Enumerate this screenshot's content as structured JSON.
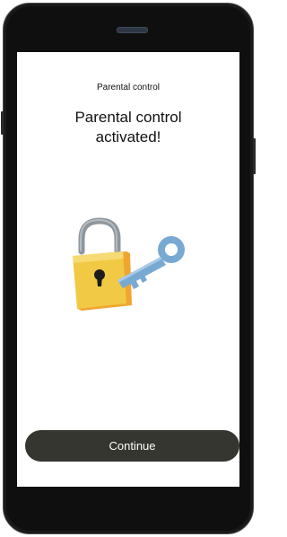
{
  "screen": {
    "header_title": "Parental control",
    "headline_line1": "Parental control",
    "headline_line2": "activated!",
    "illustration": "padlock-with-key-icon",
    "continue_label": "Continue"
  },
  "colors": {
    "button_bg": "#34362f",
    "lock_body": "#f1c945",
    "lock_shackle": "#8e979e",
    "key": "#78a9d2"
  }
}
